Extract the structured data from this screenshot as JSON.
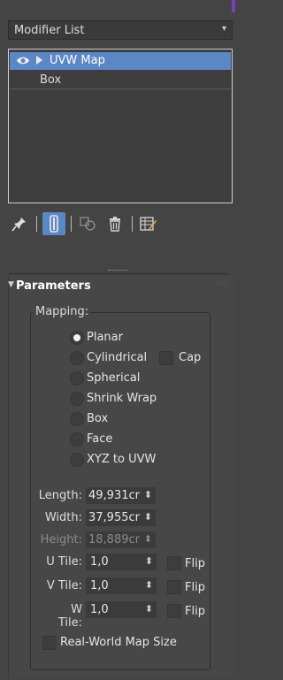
{
  "modifier_list": {
    "label": "Modifier List",
    "arrow": "▾"
  },
  "stack": {
    "items": [
      {
        "label": "UVW Map",
        "selected": true
      },
      {
        "label": "Box",
        "selected": false
      }
    ]
  },
  "toolbar": {
    "buttons": [
      "pin-icon",
      "show-end-result-icon",
      "make-unique-icon",
      "remove-modifier-icon",
      "configure-modifier-sets-icon"
    ]
  },
  "parameters": {
    "title": "Parameters",
    "mapping": {
      "label": "Mapping:",
      "options": [
        {
          "label": "Planar",
          "selected": true
        },
        {
          "label": "Cylindrical",
          "selected": false
        },
        {
          "label": "Spherical",
          "selected": false
        },
        {
          "label": "Shrink Wrap",
          "selected": false
        },
        {
          "label": "Box",
          "selected": false
        },
        {
          "label": "Face",
          "selected": false
        },
        {
          "label": "XYZ to UVW",
          "selected": false
        }
      ],
      "cap_label": "Cap"
    },
    "dimensions": {
      "length": {
        "label": "Length:",
        "value": "49,931cr"
      },
      "width": {
        "label": "Width:",
        "value": "37,955cr"
      },
      "height": {
        "label": "Height:",
        "value": "18,889cr"
      }
    },
    "tiles": {
      "u": {
        "label": "U Tile:",
        "value": "1,0",
        "flip": "Flip"
      },
      "v": {
        "label": "V Tile:",
        "value": "1,0",
        "flip": "Flip"
      },
      "w": {
        "label": "W Tile:",
        "value": "1,0",
        "flip": "Flip"
      }
    },
    "real_world": "Real-World Map Size"
  },
  "colors": {
    "accent": "#5b87c7",
    "panel": "#444444"
  }
}
